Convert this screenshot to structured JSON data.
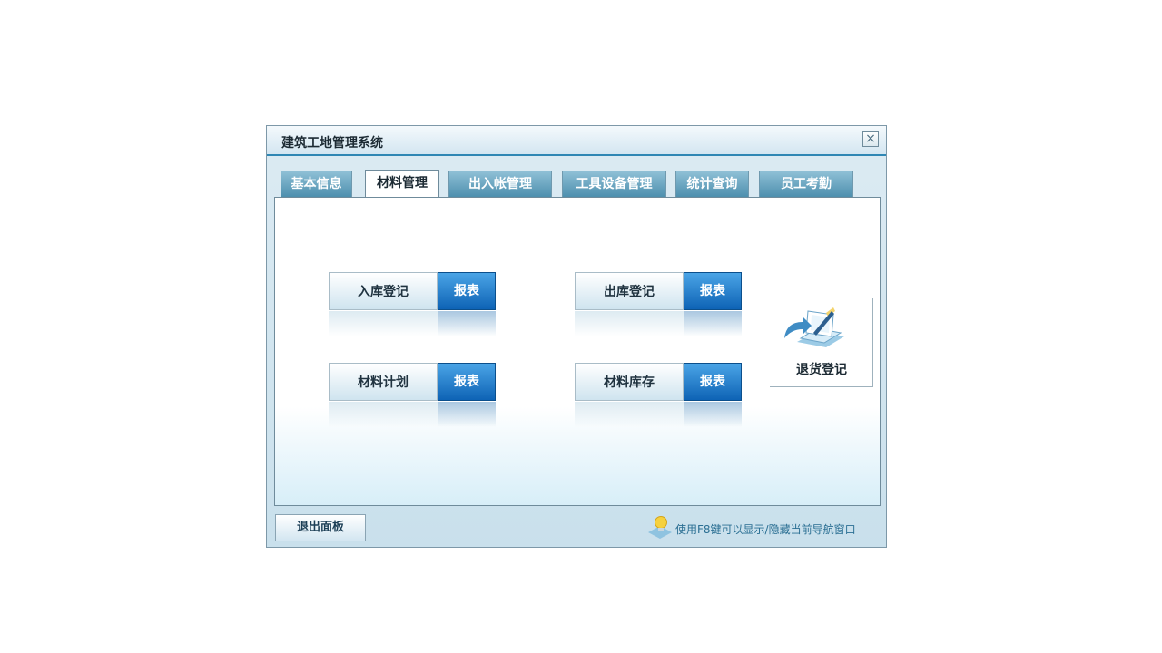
{
  "window": {
    "title": "建筑工地管理系统",
    "close_glyph": "×"
  },
  "tabs": [
    {
      "label": "基本信息",
      "active": false
    },
    {
      "label": "材料管理",
      "active": true
    },
    {
      "label": "出入帐管理",
      "active": false
    },
    {
      "label": "工具设备管理",
      "active": false
    },
    {
      "label": "统计查询",
      "active": false
    },
    {
      "label": "员工考勤",
      "active": false
    }
  ],
  "panel": {
    "buttons": [
      {
        "name": "入库登记",
        "report": "报表"
      },
      {
        "name": "出库登记",
        "report": "报表"
      },
      {
        "name": "材料计划",
        "report": "报表"
      },
      {
        "name": "材料库存",
        "report": "报表"
      }
    ],
    "return_button": {
      "label": "退货登记",
      "icon": "return-document-icon"
    }
  },
  "footer": {
    "exit_label": "退出面板",
    "hint_icon": "lightbulb-icon",
    "hint_text": "使用F8键可以显示/隐藏当前导航窗口"
  },
  "colors": {
    "accent": "#2f87b4",
    "tab": "#4d8fae",
    "report_button": "#0e63b5"
  }
}
